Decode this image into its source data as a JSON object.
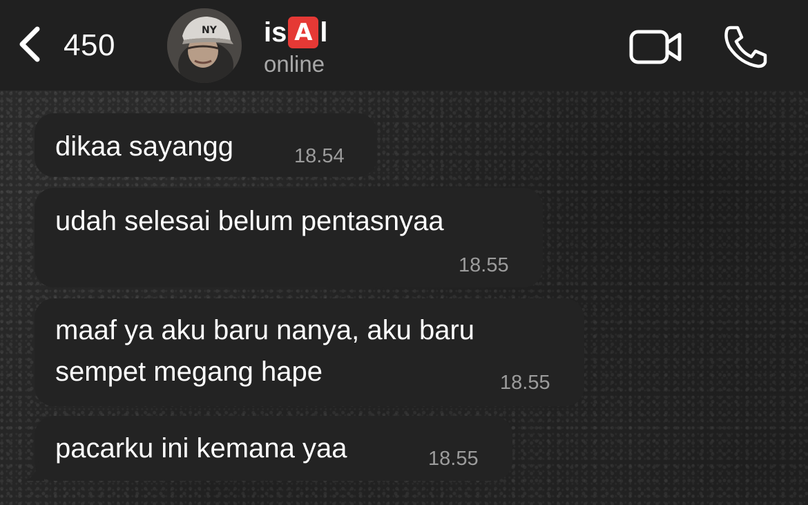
{
  "header": {
    "back_count": "450",
    "contact_name_prefix": "is",
    "contact_name_badge": "A",
    "contact_name_suffix": "l",
    "status": "online",
    "avatar_icon": "profile-photo",
    "video_icon": "video-camera-icon",
    "call_icon": "phone-icon"
  },
  "messages": [
    {
      "lines": [
        "dikaa sayangg"
      ],
      "time": "18.54"
    },
    {
      "lines": [
        "udah selesai belum pentasnyaa"
      ],
      "time": "18.55"
    },
    {
      "lines": [
        "maaf ya aku baru nanya, aku baru",
        "sempet megang hape"
      ],
      "time": "18.55"
    },
    {
      "lines": [
        "pacarku ini kemana yaa"
      ],
      "time": "18.55"
    }
  ],
  "colors": {
    "header_bg": "#202020",
    "bubble_bg": "#232323",
    "badge_red": "#e53935",
    "timestamp": "#9c9c9c"
  }
}
